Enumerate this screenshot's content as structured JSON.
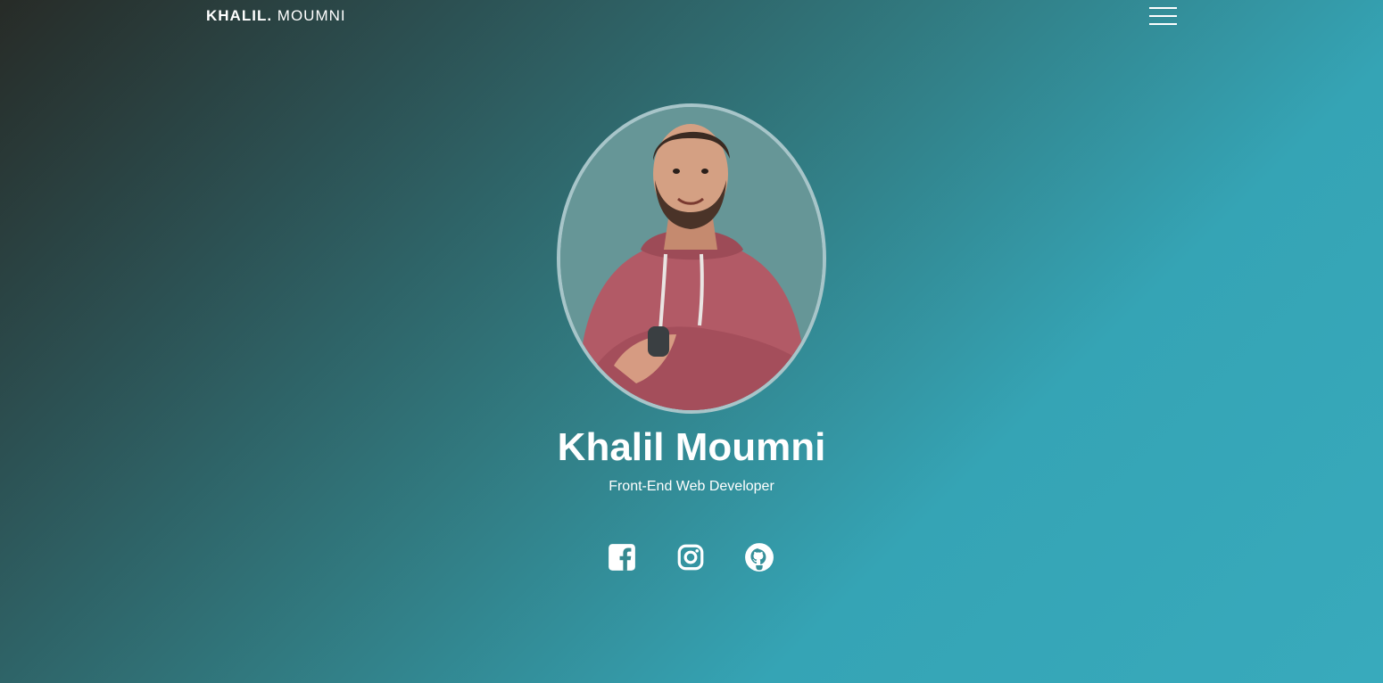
{
  "header": {
    "logo_first": "KHALIL.",
    "logo_last": "MOUMNI",
    "menu_icon": "hamburger-menu-icon"
  },
  "hero": {
    "name": "Khalil Moumni",
    "role": "Front-End Web Developer",
    "avatar_alt": "profile photo"
  },
  "socials": [
    {
      "icon": "facebook-icon",
      "label": "Facebook"
    },
    {
      "icon": "instagram-icon",
      "label": "Instagram"
    },
    {
      "icon": "github-icon",
      "label": "GitHub"
    }
  ],
  "colors": {
    "gradient_dark": "#272b27",
    "gradient_mid": "#31797f",
    "gradient_light": "#38aabc",
    "avatar_border": "#a7c5c9",
    "text": "#ffffff"
  }
}
